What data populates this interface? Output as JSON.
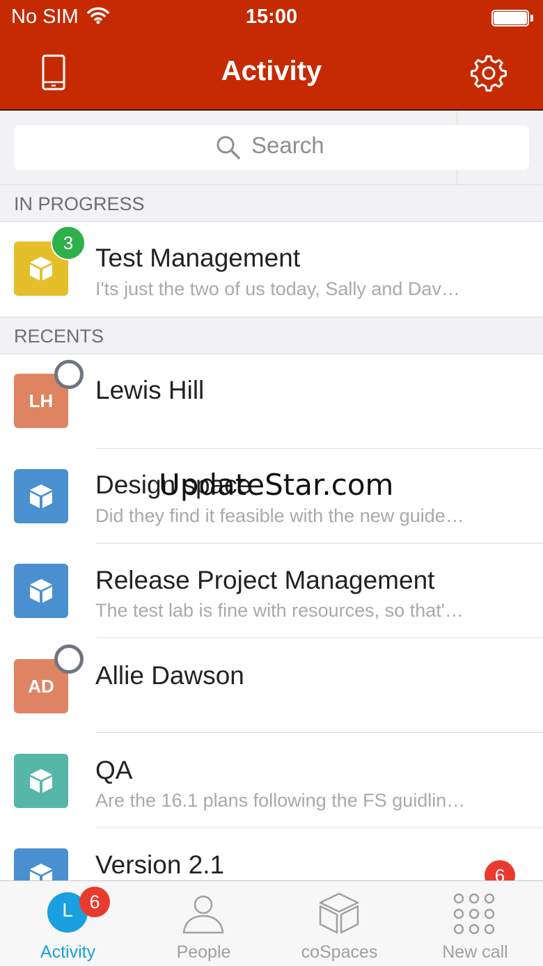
{
  "status_bar": {
    "carrier": "No SIM",
    "time": "15:00"
  },
  "header": {
    "title": "Activity",
    "left_icon": "phone-icon",
    "right_icon": "gear-icon"
  },
  "search": {
    "placeholder": "Search"
  },
  "sections": {
    "in_progress": "IN PROGRESS",
    "recents": "RECENTS"
  },
  "in_progress": [
    {
      "title": "Test Management",
      "subtitle": "I'ts just the two of us today, Sally and Dav…",
      "badge": "3",
      "color": "#e4bf2a",
      "icon": "cube-icon"
    }
  ],
  "recents": [
    {
      "title": "Lewis Hill",
      "initials": "LH",
      "color": "#de8463"
    },
    {
      "title": "Design space",
      "subtitle": "Did they find it feasible with the new guide…",
      "color": "#4a90d0",
      "icon": "cube-icon"
    },
    {
      "title": "Release Project Management",
      "subtitle": "The test lab is fine with resources, so that'…",
      "color": "#4a90d0",
      "icon": "cube-icon"
    },
    {
      "title": "Allie Dawson",
      "initials": "AD",
      "color": "#de8463"
    },
    {
      "title": "QA",
      "subtitle": "Are the 16.1 plans following the FS guidlin…",
      "color": "#56b7a8",
      "icon": "cube-icon"
    },
    {
      "title": "Version 2.1",
      "badge": "6",
      "color": "#4a90d0",
      "icon": "cube-icon"
    }
  ],
  "watermark": "UpdateStar.com",
  "tabbar": {
    "activity": {
      "label": "Activity",
      "avatar_initial": "L",
      "badge": "6"
    },
    "people": {
      "label": "People"
    },
    "cospaces": {
      "label": "coSpaces"
    },
    "new_call": {
      "label": "New call"
    }
  },
  "colors": {
    "brand": "#c52a03",
    "active_tab": "#1a9fe0",
    "inactive_tab": "#a0a0a4"
  }
}
